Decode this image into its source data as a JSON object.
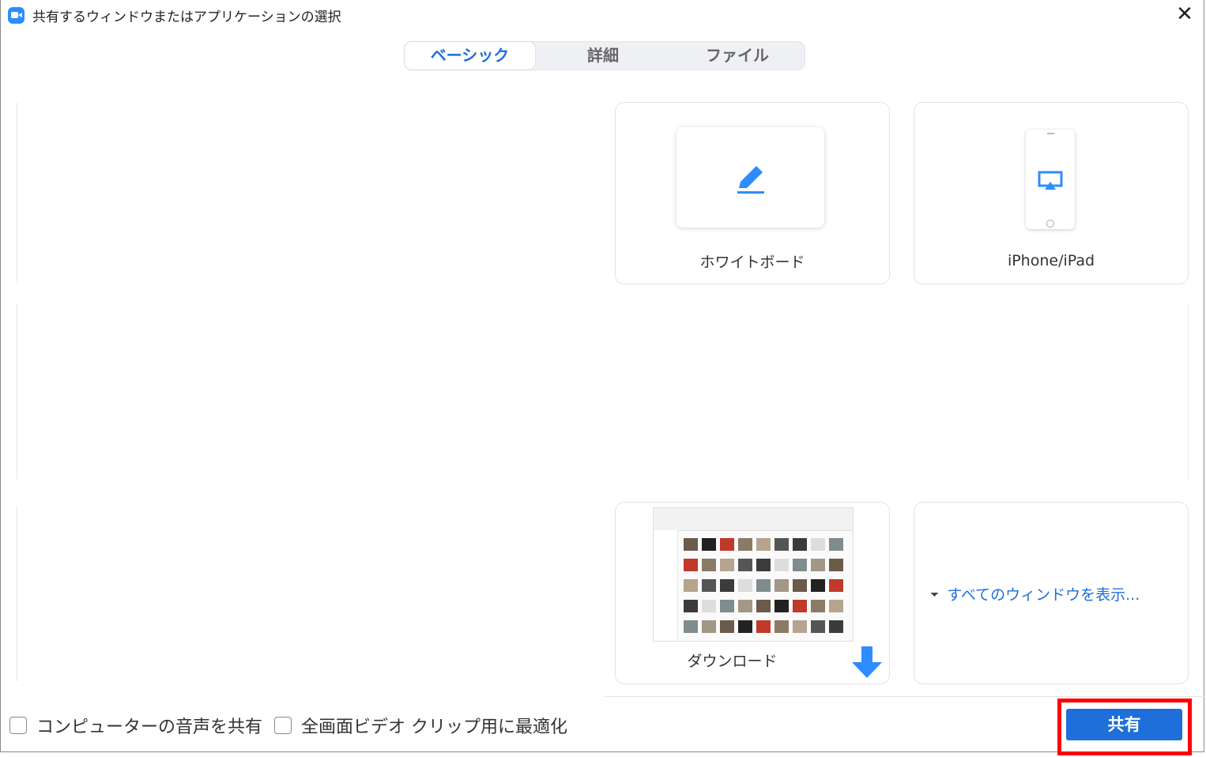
{
  "window": {
    "title": "共有するウィンドウまたはアプリケーションの選択"
  },
  "icons": {
    "app": "zoom-camera-icon",
    "close": "close-icon",
    "pencil": "pencil-icon",
    "airplay": "airplay-icon",
    "download_arrow": "arrow-down-icon",
    "chevron": "double-chevron-down-icon"
  },
  "tabs": [
    {
      "label": "ベーシック",
      "active": true
    },
    {
      "label": "詳細",
      "active": false
    },
    {
      "label": "ファイル",
      "active": false
    }
  ],
  "cards": {
    "whiteboard": {
      "label": "ホワイトボード"
    },
    "iphone": {
      "label": "iPhone/iPad"
    },
    "downloads": {
      "label": "ダウンロード"
    },
    "show_all": {
      "label": "すべてのウィンドウを表示..."
    }
  },
  "footer": {
    "share_audio": {
      "label": "コンピューターの音声を共有",
      "checked": false
    },
    "optimize_video": {
      "label": "全画面ビデオ クリップ用に最適化",
      "checked": false
    },
    "share_button": "共有"
  },
  "colors": {
    "accent": "#1e6fd9",
    "highlight_frame": "#ff0000",
    "zoom_blue": "#2d8cff"
  }
}
